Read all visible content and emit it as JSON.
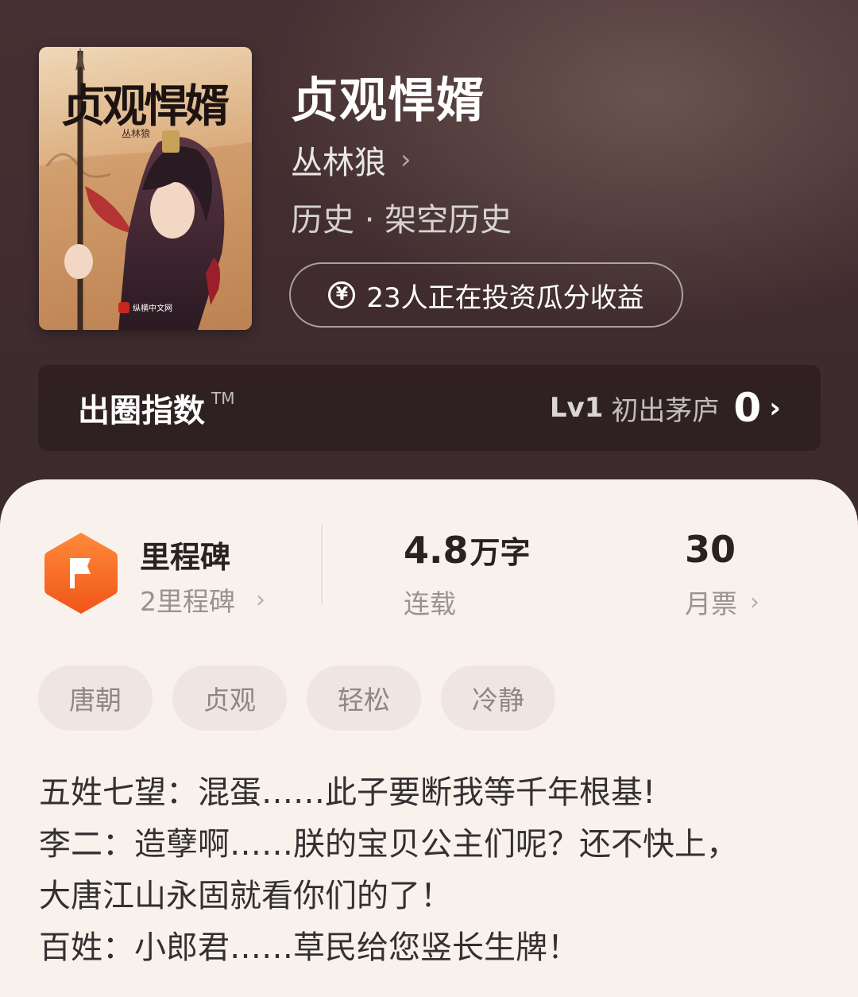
{
  "book": {
    "title": "贞观悍婿",
    "author": "丛林狼",
    "genre": "历史 · 架空历史",
    "cover": {
      "title": "贞观悍婿",
      "author": "丛林狼",
      "publisher": "纵横中文网"
    }
  },
  "invest": {
    "icon": "yen-coin-icon",
    "text": "23人正在投资瓜分收益"
  },
  "index_bar": {
    "title": "出圈指数",
    "tm": "TM",
    "level": "Lv1",
    "level_name": "初出茅庐",
    "value": "0"
  },
  "stats": {
    "milestone": {
      "label": "里程碑",
      "sub": "2里程碑",
      "icon_color": "#f26a21"
    },
    "words": {
      "value": "4.8",
      "unit": "万字",
      "label": "连载"
    },
    "tickets": {
      "value": "30",
      "label": "月票"
    }
  },
  "tags": [
    "唐朝",
    "贞观",
    "轻松",
    "冷静"
  ],
  "synopsis": [
    "五姓七望：混蛋……此子要断我等千年根基!",
    "李二：造孽啊……朕的宝贝公主们呢？还不快上，",
    "大唐江山永固就看你们的了！",
    "百姓：小郎君……草民给您竖长生牌！"
  ]
}
